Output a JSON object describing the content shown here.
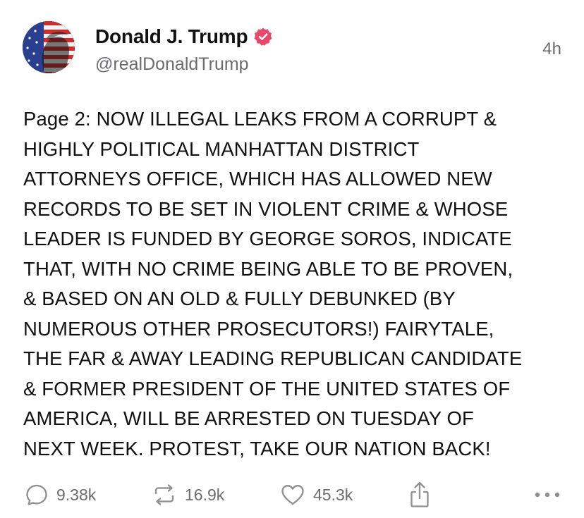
{
  "post": {
    "display_name": "Donald J. Trump",
    "handle": "@realDonaldTrump",
    "timestamp": "4h",
    "verified": true,
    "text": "Page 2: NOW ILLEGAL LEAKS FROM A CORRUPT &\nHIGHLY POLITICAL MANHATTAN DISTRICT\nATTORNEYS OFFICE, WHICH HAS ALLOWED NEW\nRECORDS TO BE SET IN VIOLENT CRIME & WHOSE\nLEADER IS FUNDED BY GEORGE SOROS, INDICATE\nTHAT, WITH NO CRIME BEING ABLE TO BE PROVEN,\n& BASED ON AN OLD & FULLY DEBUNKED (BY\nNUMEROUS OTHER PROSECUTORS!) FAIRYTALE,\nTHE FAR & AWAY LEADING REPUBLICAN CANDIDATE\n& FORMER PRESIDENT OF THE UNITED STATES OF\nAMERICA, WILL BE ARRESTED ON TUESDAY OF\nNEXT WEEK. PROTEST, TAKE OUR NATION BACK!"
  },
  "actions": {
    "replies": "9.38k",
    "retruths": "16.9k",
    "likes": "45.3k",
    "reply_icon": "reply-bubble-icon",
    "retruth_icon": "retruth-icon",
    "like_icon": "heart-icon",
    "share_icon": "share-icon",
    "more_icon": "more-dots-icon"
  },
  "colors": {
    "verified_badge": "#e8496a",
    "muted_text": "#6b6b70",
    "body_text": "#111111",
    "background": "#ffffff"
  }
}
